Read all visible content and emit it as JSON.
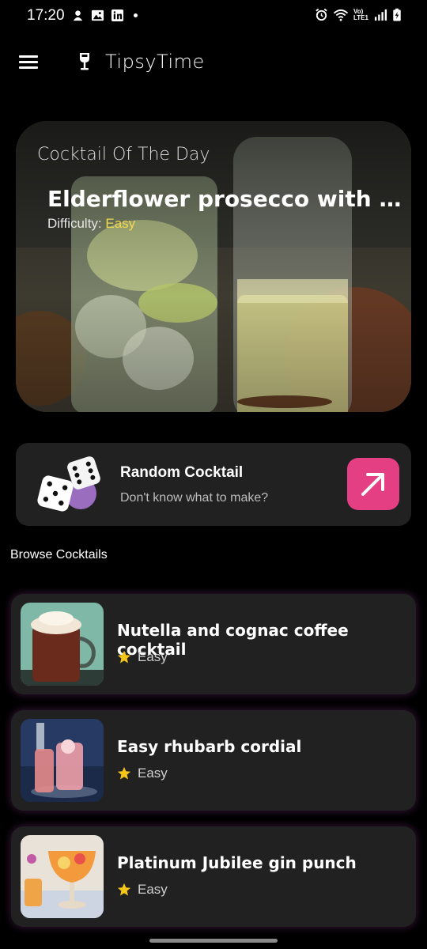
{
  "status_bar": {
    "time": "17:20",
    "left_icons": [
      "app-notification-icon",
      "gallery-icon",
      "linkedin-icon",
      "more-dot-icon"
    ],
    "right_icons": [
      "alarm-icon",
      "wifi-icon",
      "volte-lte-icon",
      "signal-icon",
      "battery-charging-icon"
    ],
    "network_label": "Vo) LTE1"
  },
  "app_bar": {
    "title": "TipsyTime",
    "menu_icon": "hamburger-menu-icon",
    "logo_icon": "wine-glass-icon"
  },
  "hero": {
    "kicker": "Cocktail Of The Day",
    "title": "Elderflower prosecco with ...",
    "difficulty_label": "Difficulty: ",
    "difficulty_value": "Easy"
  },
  "random_card": {
    "title": "Random Cocktail",
    "subtitle": "Don't know what to make?",
    "dice_icon": "dice-icon",
    "action_icon": "arrow-up-right-icon",
    "accent": "#e43f82"
  },
  "browse": {
    "label": "Browse Cocktails",
    "items": [
      {
        "title": "Nutella and cognac coffee cocktail",
        "difficulty": "Easy"
      },
      {
        "title": "Easy rhubarb cordial",
        "difficulty": "Easy"
      },
      {
        "title": "Platinum Jubilee gin punch",
        "difficulty": "Easy"
      }
    ]
  },
  "colors": {
    "background": "#000000",
    "card": "#212121",
    "accent_pink": "#e43f82",
    "difficulty_yellow": "#f2d94e",
    "star_yellow": "#f5c518"
  }
}
